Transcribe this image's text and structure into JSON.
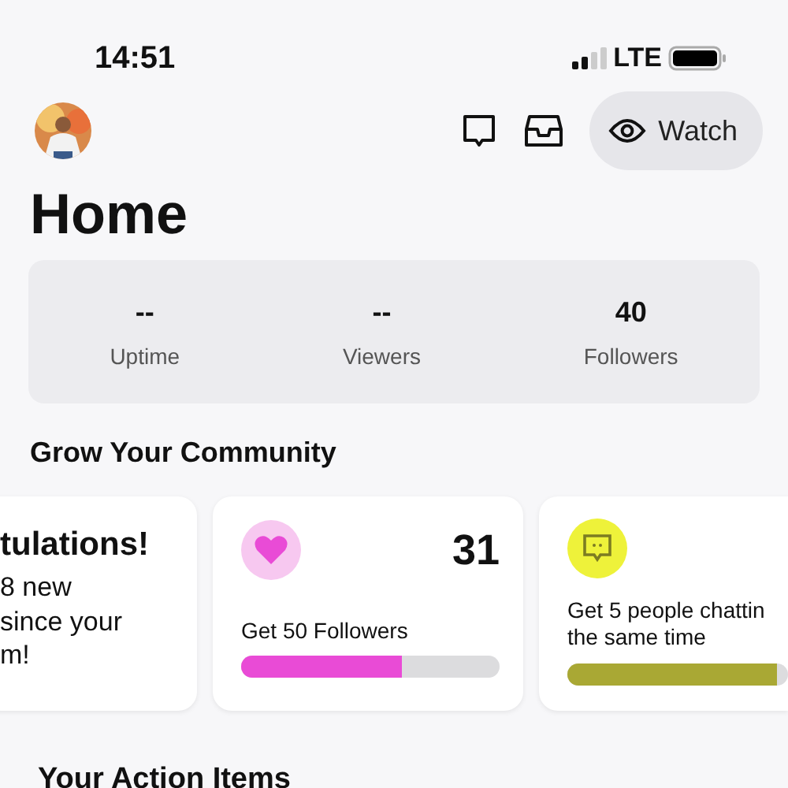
{
  "status_bar": {
    "time": "14:51",
    "network": "LTE"
  },
  "header": {
    "watch_button": "Watch"
  },
  "title": "Home",
  "stats": [
    {
      "value": "--",
      "label": "Uptime"
    },
    {
      "value": "--",
      "label": "Viewers"
    },
    {
      "value": "40",
      "label": "Followers"
    }
  ],
  "community": {
    "heading": "Grow Your Community",
    "cards": [
      {
        "kind": "message",
        "title": "tulations!",
        "lines": [
          "8 new",
          "since your",
          "m!"
        ]
      },
      {
        "kind": "follower_goal",
        "count": "31",
        "text": "Get 50 Followers",
        "level": 0.62,
        "color": "#e94bd6"
      },
      {
        "kind": "chat_goal",
        "text": "Get 5 people chattin",
        "text_line2": "the same time",
        "level": 0.95,
        "color": "#a9a834"
      }
    ]
  },
  "action_items": {
    "heading": "Your Action Items"
  }
}
